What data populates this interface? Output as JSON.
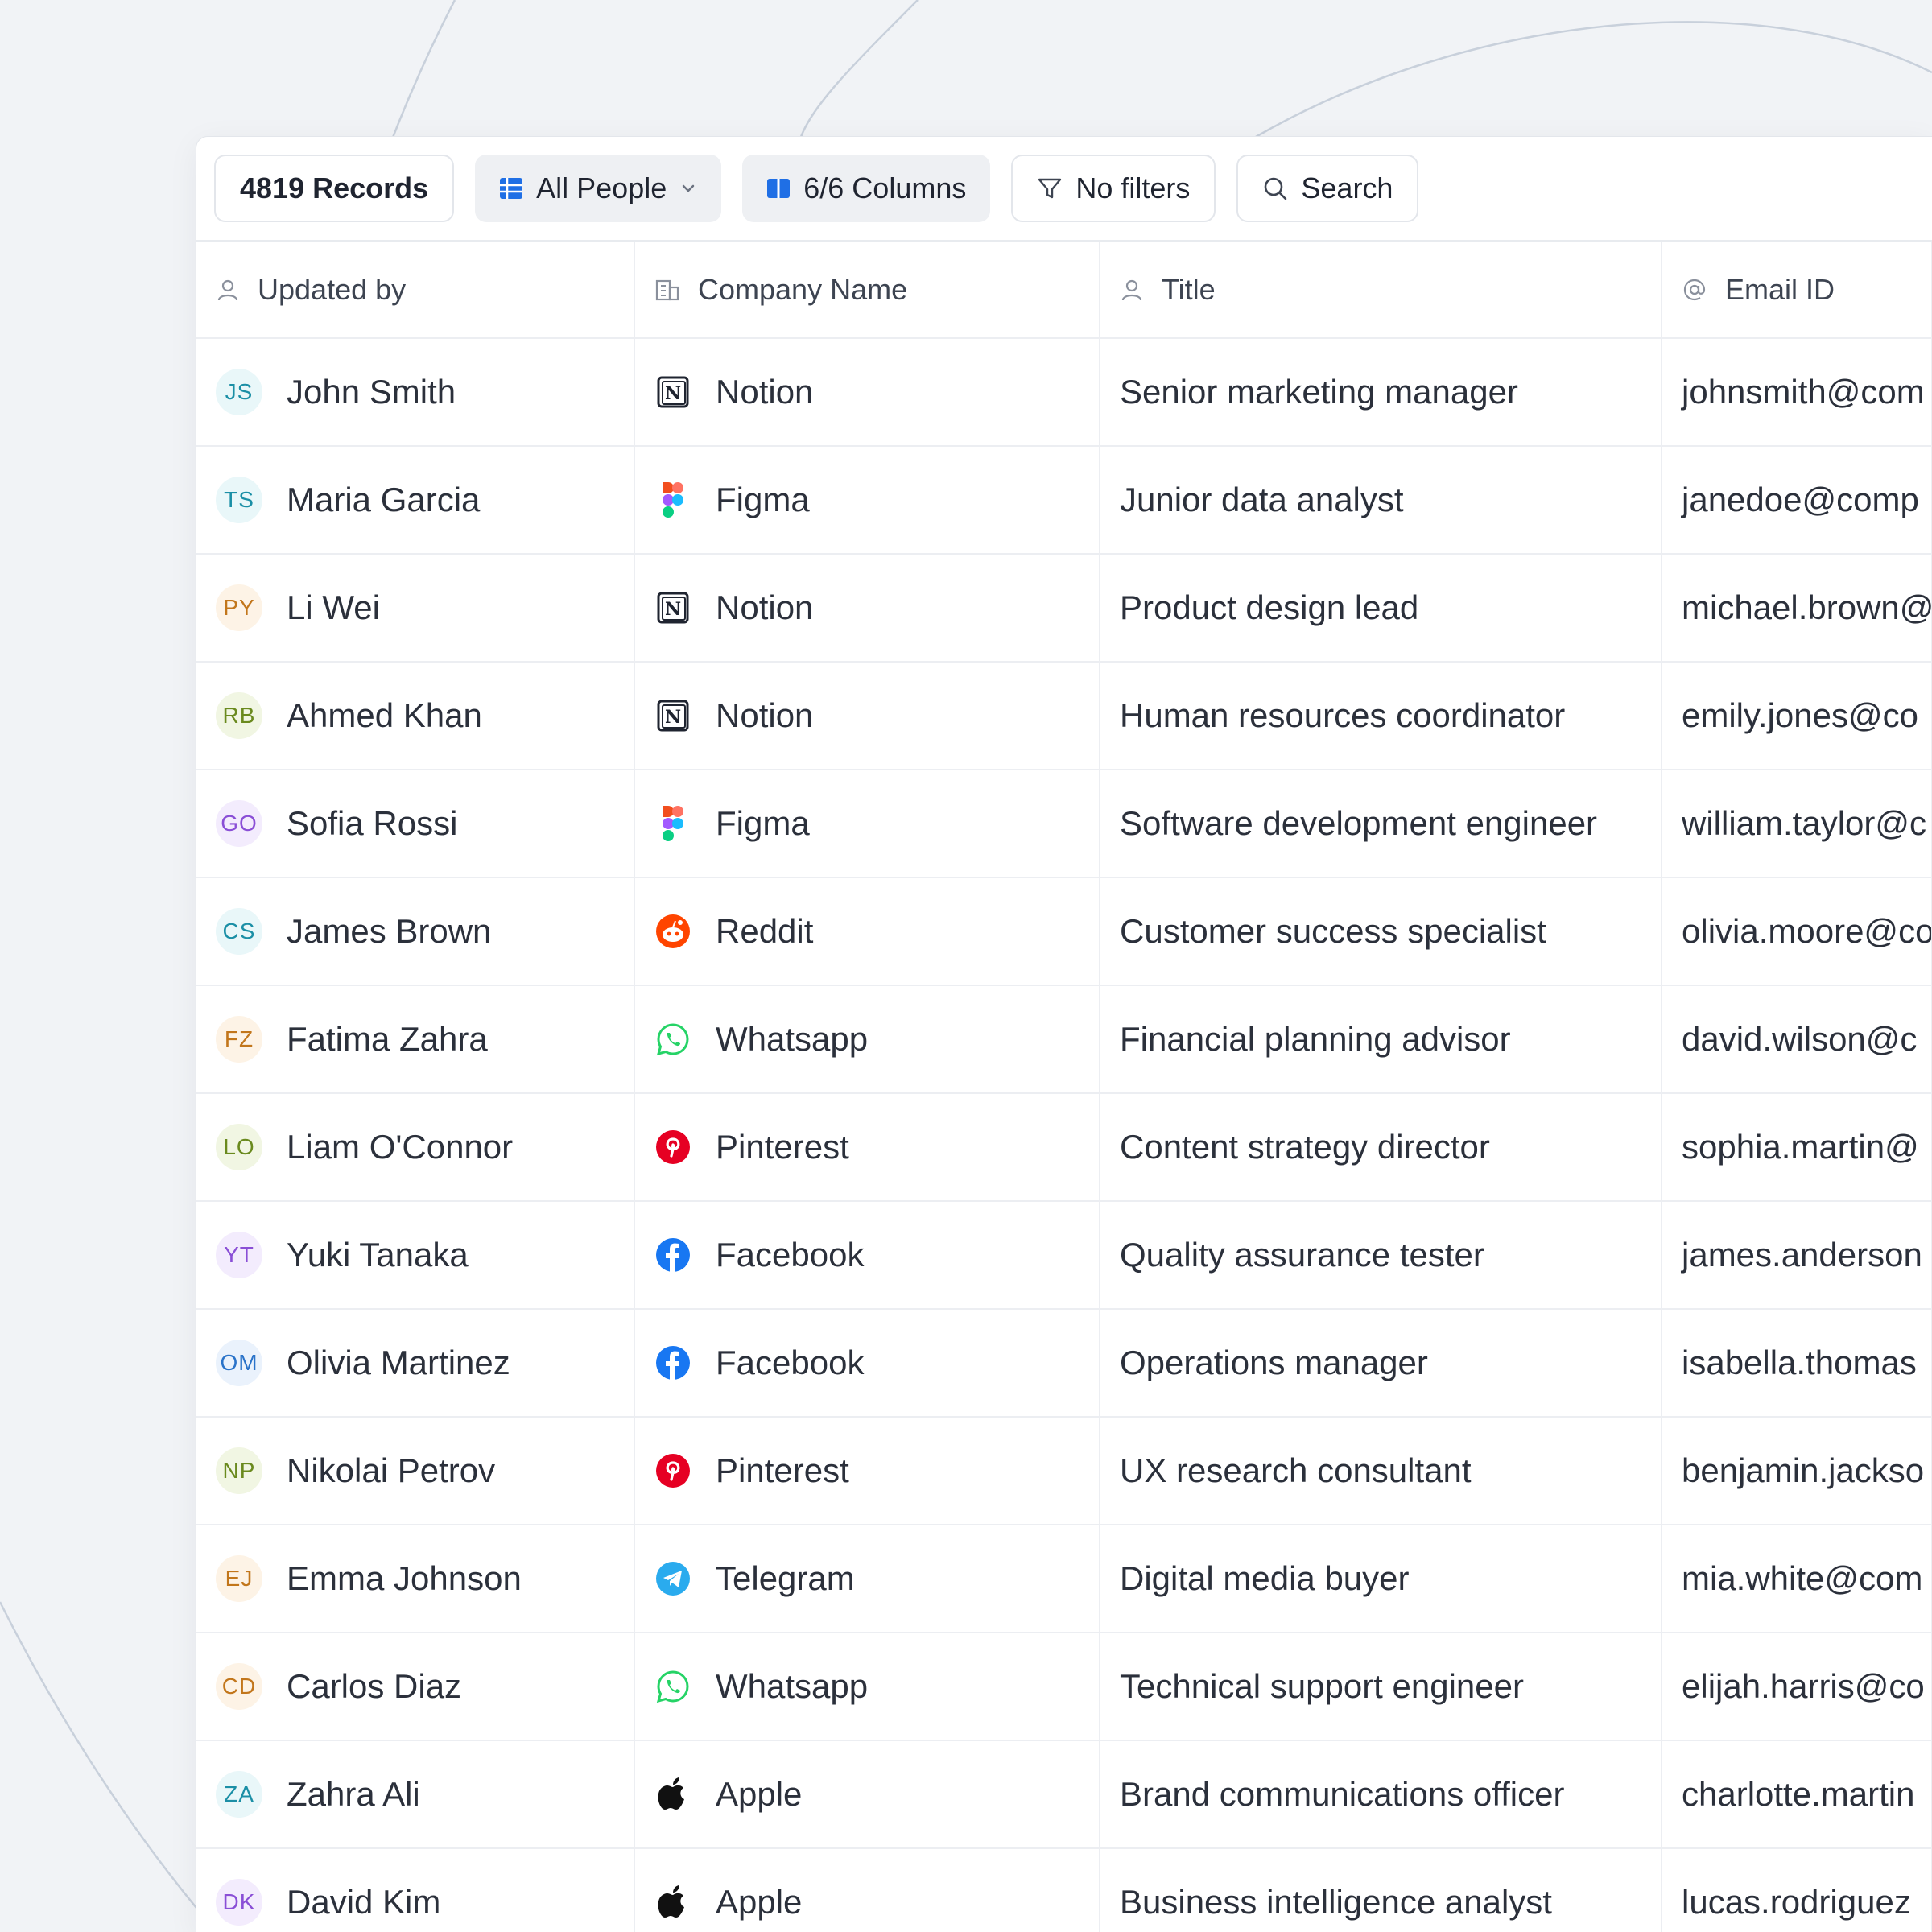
{
  "toolbar": {
    "records_label": "4819 Records",
    "view_label": "All People",
    "columns_label": "6/6 Columns",
    "filters_label": "No filters",
    "search_label": "Search"
  },
  "columns": [
    {
      "label": "Updated by",
      "icon": "user-icon"
    },
    {
      "label": "Company Name",
      "icon": "building-icon"
    },
    {
      "label": "Title",
      "icon": "user-icon"
    },
    {
      "label": "Email ID",
      "icon": "at-icon"
    }
  ],
  "rows": [
    {
      "initials": "JS",
      "name": "John Smith",
      "company": "Notion",
      "title": "Senior marketing manager",
      "email": "johnsmith@com"
    },
    {
      "initials": "TS",
      "name": "Maria Garcia",
      "company": "Figma",
      "title": "Junior data analyst",
      "email": "janedoe@comp"
    },
    {
      "initials": "PY",
      "name": "Li Wei",
      "company": "Notion",
      "title": "Product design lead",
      "email": "michael.brown@"
    },
    {
      "initials": "RB",
      "name": "Ahmed Khan",
      "company": "Notion",
      "title": "Human resources coordinator",
      "email": "emily.jones@co"
    },
    {
      "initials": "GO",
      "name": "Sofia Rossi",
      "company": "Figma",
      "title": "Software development engineer",
      "email": "william.taylor@c"
    },
    {
      "initials": "CS",
      "name": "James Brown",
      "company": "Reddit",
      "title": "Customer success specialist",
      "email": "olivia.moore@co"
    },
    {
      "initials": "FZ",
      "name": "Fatima Zahra",
      "company": "Whatsapp",
      "title": "Financial planning advisor",
      "email": "david.wilson@c"
    },
    {
      "initials": "LO",
      "name": "Liam O'Connor",
      "company": "Pinterest",
      "title": "Content strategy director",
      "email": "sophia.martin@"
    },
    {
      "initials": "YT",
      "name": "Yuki Tanaka",
      "company": "Facebook",
      "title": "Quality assurance tester",
      "email": "james.anderson"
    },
    {
      "initials": "OM",
      "name": "Olivia Martinez",
      "company": "Facebook",
      "title": "Operations manager",
      "email": "isabella.thomas"
    },
    {
      "initials": "NP",
      "name": "Nikolai Petrov",
      "company": "Pinterest",
      "title": "UX research consultant",
      "email": "benjamin.jackso"
    },
    {
      "initials": "EJ",
      "name": "Emma Johnson",
      "company": "Telegram",
      "title": "Digital media buyer",
      "email": "mia.white@com"
    },
    {
      "initials": "CD",
      "name": "Carlos Diaz",
      "company": "Whatsapp",
      "title": "Technical support engineer",
      "email": "elijah.harris@co"
    },
    {
      "initials": "ZA",
      "name": "Zahra Ali",
      "company": "Apple",
      "title": "Brand communications officer",
      "email": "charlotte.martin"
    },
    {
      "initials": "DK",
      "name": "David Kim",
      "company": "Apple",
      "title": "Business intelligence analyst",
      "email": "lucas.rodriguez"
    }
  ],
  "colors": {
    "accent": "#1f6fe5",
    "avatar_teal": "#1b8fa6",
    "avatar_orange": "#c2761b",
    "avatar_green": "#6a8a1e",
    "avatar_purple": "#8a4fd6",
    "avatar_blue": "#2a73c9"
  }
}
